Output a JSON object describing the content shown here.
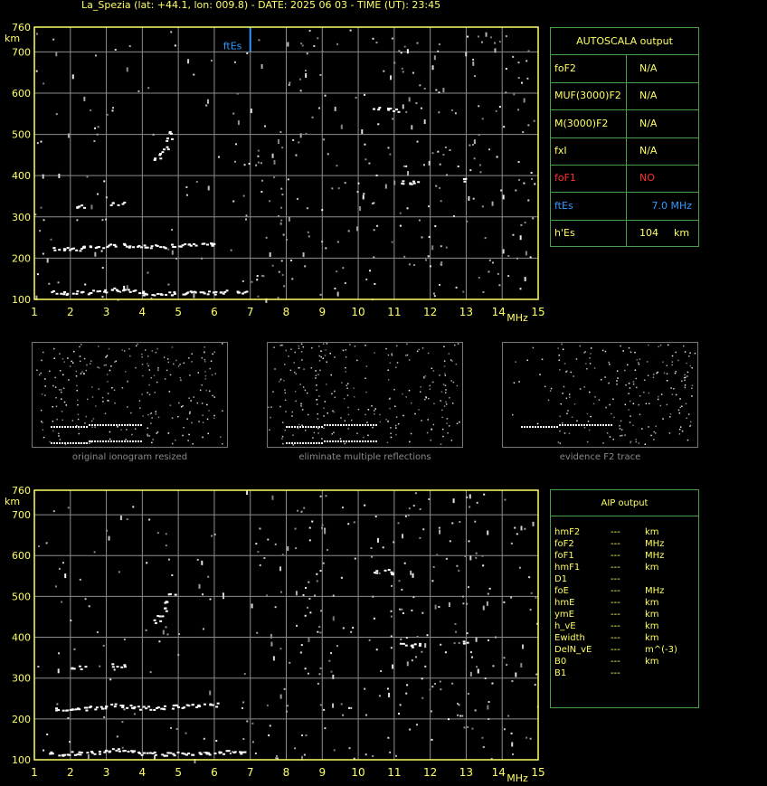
{
  "header": {
    "title": "La_Spezia (lat: +44.1, lon: 009.8) - DATE: 2025 06 03 - TIME (UT): 23:45"
  },
  "chart_data": [
    {
      "type": "scatter",
      "title": "",
      "xlabel": "MHz",
      "ylabel": "km",
      "xlim": [
        1,
        15
      ],
      "ylim": [
        100,
        760
      ],
      "x_ticks": [
        "1",
        "2",
        "3",
        "4",
        "5",
        "6",
        "7",
        "8",
        "9",
        "10",
        "11",
        "12",
        "13",
        "14",
        "15"
      ],
      "y_ticks": [
        "100",
        "200",
        "300",
        "400",
        "500",
        "600",
        "700",
        "760"
      ],
      "fbEs_marker": {
        "label": "ftEs",
        "x": 7.0,
        "y_from": 700,
        "y_to": 760
      },
      "series": [
        {
          "name": "",
          "values": [
            [
              1.5,
              118
            ],
            [
              1.7,
              116
            ],
            [
              1.9,
              117
            ],
            [
              2.1,
              118
            ],
            [
              2.3,
              117
            ],
            [
              2.5,
              118
            ],
            [
              2.7,
              120
            ],
            [
              2.9,
              122
            ],
            [
              3.1,
              125
            ],
            [
              3.3,
              124
            ],
            [
              3.5,
              122
            ],
            [
              3.7,
              120
            ],
            [
              3.9,
              118
            ],
            [
              4.1,
              116
            ],
            [
              4.3,
              116
            ],
            [
              4.5,
              115
            ],
            [
              4.7,
              115
            ],
            [
              4.9,
              116
            ],
            [
              5.1,
              116
            ],
            [
              5.3,
              117
            ],
            [
              5.5,
              117
            ],
            [
              5.7,
              118
            ],
            [
              5.9,
              118
            ],
            [
              6.1,
              119
            ],
            [
              6.3,
              120
            ],
            [
              6.6,
              118
            ],
            [
              6.8,
              120
            ],
            [
              1.6,
              225
            ],
            [
              1.8,
              224
            ],
            [
              2.0,
              223
            ],
            [
              2.2,
              224
            ],
            [
              2.4,
              226
            ],
            [
              2.6,
              228
            ],
            [
              2.8,
              230
            ],
            [
              3.0,
              232
            ],
            [
              3.2,
              234
            ],
            [
              3.4,
              233
            ],
            [
              3.6,
              231
            ],
            [
              3.8,
              230
            ],
            [
              4.0,
              229
            ],
            [
              4.2,
              228
            ],
            [
              4.4,
              229
            ],
            [
              4.6,
              230
            ],
            [
              4.8,
              231
            ],
            [
              5.0,
              232
            ],
            [
              5.2,
              232
            ],
            [
              5.4,
              233
            ],
            [
              5.6,
              234
            ],
            [
              5.8,
              235
            ],
            [
              6.0,
              236
            ],
            [
              2.1,
              327
            ],
            [
              2.3,
              327
            ],
            [
              3.2,
              333
            ],
            [
              3.4,
              333
            ],
            [
              4.4,
              440
            ],
            [
              4.5,
              455
            ],
            [
              4.6,
              470
            ],
            [
              4.7,
              490
            ],
            [
              4.8,
              505
            ],
            [
              10.5,
              563
            ],
            [
              10.8,
              563
            ],
            [
              11.0,
              560
            ],
            [
              11.2,
              385
            ],
            [
              11.4,
              380
            ],
            [
              11.6,
              385
            ],
            [
              13.0,
              390
            ]
          ]
        }
      ]
    },
    {
      "type": "scatter",
      "title": "",
      "xlabel": "MHz",
      "ylabel": "km",
      "xlim": [
        1,
        15
      ],
      "ylim": [
        100,
        760
      ],
      "x_ticks": [
        "1",
        "2",
        "3",
        "4",
        "5",
        "6",
        "7",
        "8",
        "9",
        "10",
        "11",
        "12",
        "13",
        "14",
        "15"
      ],
      "y_ticks": [
        "100",
        "200",
        "300",
        "400",
        "500",
        "600",
        "700",
        "760"
      ]
    }
  ],
  "autoscala": {
    "title": "AUTOSCALA output",
    "rows": [
      {
        "label": "foF2",
        "value": "N/A",
        "unit": "",
        "color": "#ffff66"
      },
      {
        "label": "MUF(3000)F2",
        "value": "N/A",
        "unit": "",
        "color": "#ffff66"
      },
      {
        "label": "M(3000)F2",
        "value": "N/A",
        "unit": "",
        "color": "#ffff66"
      },
      {
        "label": "fxI",
        "value": "N/A",
        "unit": "",
        "color": "#ffff66"
      },
      {
        "label": "foF1",
        "value": "NO",
        "unit": "",
        "color": "#ff3030"
      },
      {
        "label": "ftEs",
        "value": "7.0 MHz",
        "unit": "",
        "color": "#3399ff"
      },
      {
        "label": "h'Es",
        "value": "104",
        "unit": "km",
        "color": "#ffff66"
      }
    ]
  },
  "thumbnails": [
    {
      "caption": "original ionogram resized"
    },
    {
      "caption": "eliminate multiple reflections"
    },
    {
      "caption": "evidence F2 trace"
    }
  ],
  "aip": {
    "title": "AIP output",
    "rows": [
      {
        "label": "hmF2",
        "value": "---",
        "unit": "km"
      },
      {
        "label": "foF2",
        "value": "---",
        "unit": "MHz"
      },
      {
        "label": "foF1",
        "value": "---",
        "unit": "MHz"
      },
      {
        "label": "hmF1",
        "value": "---",
        "unit": "km"
      },
      {
        "label": "D1",
        "value": "---",
        "unit": ""
      },
      {
        "label": "foE",
        "value": "---",
        "unit": "MHz"
      },
      {
        "label": "hmE",
        "value": "---",
        "unit": "km"
      },
      {
        "label": "ymE",
        "value": "---",
        "unit": "km"
      },
      {
        "label": "h_vE",
        "value": "---",
        "unit": "km"
      },
      {
        "label": "Ewidth",
        "value": "---",
        "unit": "km"
      },
      {
        "label": "DelN_vE",
        "value": "---",
        "unit": "m^(-3)"
      },
      {
        "label": "B0",
        "value": "---",
        "unit": "km"
      },
      {
        "label": "B1",
        "value": "---",
        "unit": ""
      }
    ]
  },
  "colors": {
    "axis": "#ffff66",
    "grid": "#8c8c8c",
    "marker": "#3399ff",
    "frame": "#4c9e4c"
  }
}
